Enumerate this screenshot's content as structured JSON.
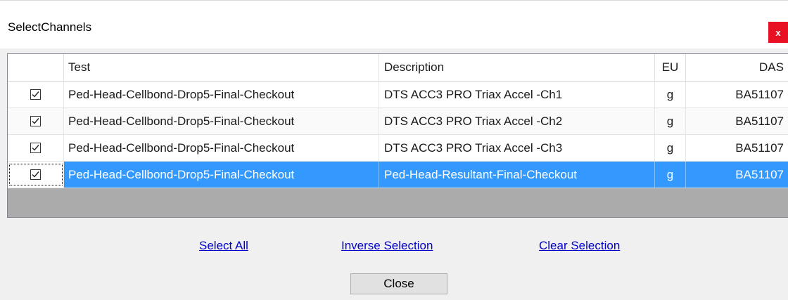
{
  "window": {
    "title": "SelectChannels",
    "close_glyph": "x"
  },
  "grid": {
    "columns": [
      "",
      "Test",
      "Description",
      "EU",
      "DAS"
    ],
    "rows": [
      {
        "checked": true,
        "test": "Ped-Head-Cellbond-Drop5-Final-Checkout",
        "description": "DTS ACC3 PRO Triax Accel -Ch1",
        "eu": "g",
        "das": "BA51107",
        "selected": false
      },
      {
        "checked": true,
        "test": "Ped-Head-Cellbond-Drop5-Final-Checkout",
        "description": "DTS ACC3 PRO Triax Accel -Ch2",
        "eu": "g",
        "das": "BA51107",
        "selected": false
      },
      {
        "checked": true,
        "test": "Ped-Head-Cellbond-Drop5-Final-Checkout",
        "description": "DTS ACC3 PRO Triax Accel -Ch3",
        "eu": "g",
        "das": "BA51107",
        "selected": false
      },
      {
        "checked": true,
        "test": "Ped-Head-Cellbond-Drop5-Final-Checkout",
        "description": "Ped-Head-Resultant-Final-Checkout",
        "eu": "g",
        "das": "BA51107",
        "selected": true
      }
    ]
  },
  "actions": {
    "select_all": "Select All",
    "inverse_selection": "Inverse Selection",
    "clear_selection": "Clear Selection",
    "close": "Close"
  },
  "colors": {
    "selection": "#3399ff",
    "link": "#0000cc",
    "close_button_bg": "#e81123"
  }
}
